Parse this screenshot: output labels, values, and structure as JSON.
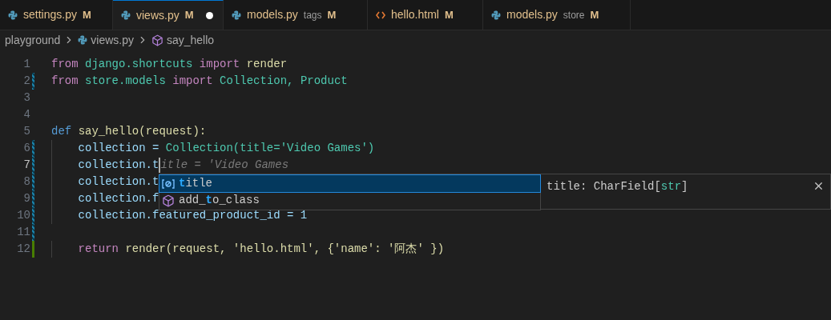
{
  "tabs": [
    {
      "name": "settings.py",
      "kind": "python",
      "status": "M",
      "selected": false,
      "dirty": false
    },
    {
      "name": "views.py",
      "kind": "python",
      "status": "M",
      "selected": true,
      "dirty": true
    },
    {
      "name": "models.py",
      "description": "tags",
      "kind": "python",
      "status": "M",
      "selected": false,
      "dirty": false
    },
    {
      "name": "hello.html",
      "kind": "html",
      "status": "M",
      "selected": false,
      "dirty": false
    },
    {
      "name": "models.py",
      "description": "store",
      "kind": "python",
      "status": "M",
      "selected": false,
      "dirty": false
    }
  ],
  "breadcrumbs": [
    {
      "label": "playground",
      "kind": "folder"
    },
    {
      "label": "views.py",
      "kind": "python"
    },
    {
      "label": "say_hello",
      "kind": "function"
    }
  ],
  "editor": {
    "lines": [
      {
        "number": "1",
        "modified": false,
        "added": false,
        "current": false,
        "indented": false,
        "tokens": [
          {
            "kind": "keyword",
            "text": "from"
          },
          {
            "kind": "module",
            "text": "django.shortcuts"
          },
          {
            "kind": "keyword",
            "text": "import"
          },
          {
            "kind": "function",
            "text": "render"
          }
        ]
      },
      {
        "number": "2",
        "modified": true,
        "added": false,
        "current": false,
        "indented": false,
        "tokens": [
          {
            "kind": "keyword",
            "text": "from"
          },
          {
            "kind": "module",
            "text": "store.models"
          },
          {
            "kind": "keyword",
            "text": "import"
          },
          {
            "kind": "class",
            "text": "Collection, Product"
          }
        ]
      },
      {
        "number": "3",
        "modified": false,
        "added": false,
        "current": false,
        "indented": false
      },
      {
        "number": "4",
        "modified": false,
        "added": false,
        "current": false,
        "indented": false
      },
      {
        "number": "5",
        "modified": false,
        "added": false,
        "current": false,
        "indented": false,
        "tokens": [
          {
            "kind": "storage",
            "text": "def"
          },
          {
            "kind": "function",
            "text": "say_hello(request):"
          }
        ]
      },
      {
        "number": "6",
        "modified": true,
        "added": false,
        "current": false,
        "indented": true,
        "tokens": [
          {
            "kind": "variable",
            "text": "collection ="
          },
          {
            "kind": "class",
            "text": "Collection(title='Video Games')"
          }
        ]
      },
      {
        "number": "7",
        "modified": true,
        "added": false,
        "current": true,
        "indented": true,
        "tokens": [
          {
            "kind": "variable",
            "text": "collection.t"
          },
          {
            "kind": "cursor"
          },
          {
            "kind": "ghost",
            "text": "itle = 'Video Games"
          }
        ]
      },
      {
        "number": "8",
        "modified": true,
        "added": false,
        "current": false,
        "indented": true,
        "tokens": [
          {
            "kind": "variable",
            "text": "collection.t"
          }
        ]
      },
      {
        "number": "9",
        "modified": true,
        "added": false,
        "current": false,
        "indented": true,
        "tokens": [
          {
            "kind": "variable",
            "text": "collection.f"
          }
        ]
      },
      {
        "number": "10",
        "modified": true,
        "added": false,
        "current": false,
        "indented": true,
        "tokens": [
          {
            "kind": "variable",
            "text": "collection.featured_product_id = 1"
          }
        ]
      },
      {
        "number": "11",
        "modified": true,
        "added": false,
        "current": false,
        "indented": false
      },
      {
        "number": "12",
        "modified": false,
        "added": true,
        "current": false,
        "indented": true,
        "tokens": [
          {
            "kind": "keyword",
            "text": "return"
          },
          {
            "kind": "function",
            "text": "render(request, 'hello.html', {'name': '阿杰' })"
          }
        ]
      }
    ]
  },
  "suggestions": {
    "items": [
      {
        "kind": "field",
        "match": "t",
        "after": "itle",
        "selected": true
      },
      {
        "kind": "method",
        "before": "add_",
        "match": "t",
        "after": "o_class",
        "selected": false
      }
    ],
    "details": {
      "signature": "title: CharField[",
      "type": "str",
      "end": "]"
    }
  }
}
